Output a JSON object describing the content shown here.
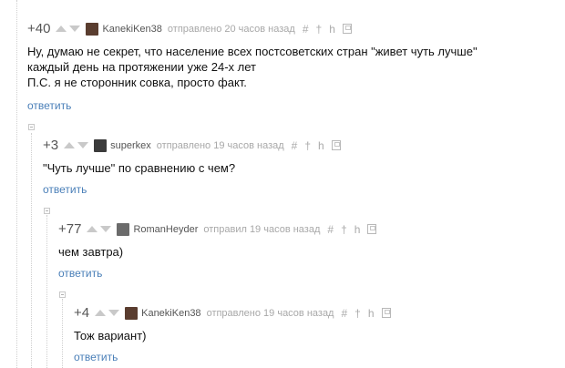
{
  "comments": [
    {
      "rating": "+40",
      "user": "KanekiKen38",
      "meta": "отправлено 20 часов назад",
      "text": "Ну, думаю не секрет, что население всех постсоветских стран \"живет чуть лучше\"\nкаждый день на протяжении уже 24-х лет\nП.С. я не сторонник совка, просто факт.",
      "reply": "ответить",
      "avatar_color": "#5a3d2f"
    },
    {
      "rating": "+3",
      "user": "superkex",
      "meta": "отправлено 19 часов назад",
      "text": "\"Чуть лучше\" по сравнению с чем?",
      "reply": "ответить",
      "avatar_color": "#3b3b3b"
    },
    {
      "rating": "+77",
      "user": "RomanHeyder",
      "meta": "отправил 19 часов назад",
      "text": "чем завтра)",
      "reply": "ответить",
      "avatar_color": "#6b6b6b"
    },
    {
      "rating": "+4",
      "user": "KanekiKen38",
      "meta": "отправлено 19 часов назад",
      "text": "Тож вариант)",
      "reply": "ответить",
      "avatar_color": "#5a3d2f"
    }
  ],
  "tools": {
    "hash": "#",
    "pin": "†",
    "parent": "h"
  }
}
